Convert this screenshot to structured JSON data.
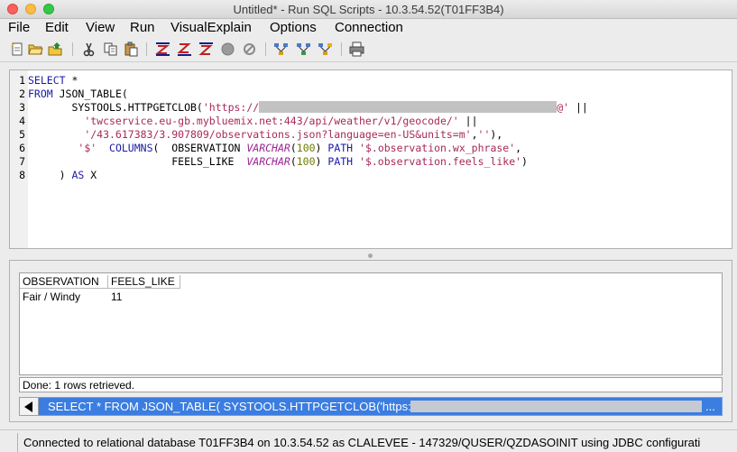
{
  "window": {
    "title": "Untitled* - Run SQL Scripts - 10.3.54.52(T01FF3B4)"
  },
  "menu": [
    "File",
    "Edit",
    "View",
    "Run",
    "VisualExplain",
    "Options",
    "Connection"
  ],
  "editor": {
    "line_numbers": [
      "1",
      "2",
      "3",
      "4",
      "5",
      "6",
      "7",
      "8"
    ],
    "lines": {
      "l1_kw": "SELECT",
      "l1_rest": " *",
      "l2_kw": "FROM",
      "l2_rest": " JSON_TABLE(",
      "l3_pre": "       SYSTOOLS.HTTPGETCLOB(",
      "l3_str1": "'https://",
      "l3_str2": "@'",
      "l3_post": " ||",
      "l4_str": "'twcservice.eu-gb.mybluemix.net:443/api/weather/v1/geocode/'",
      "l4_post": " ||",
      "l5_str": "'/43.617383/3.907809/observations.json?language=en-US&units=m'",
      "l5_mid": ",",
      "l5_str2": "''",
      "l5_post": "),",
      "l6_str": "'$'",
      "l6_kw": "COLUMNS",
      "l6_col": "(  OBSERVATION ",
      "l6_type": "VARCHAR",
      "l6_num": "100",
      "l6_kw2": "PATH",
      "l6_path": "'$.observation.wx_phrase'",
      "l6_end": ",",
      "l7_col": "FEELS_LIKE  ",
      "l7_type": "VARCHAR",
      "l7_num": "100",
      "l7_kw2": "PATH",
      "l7_path": "'$.observation.feels_like'",
      "l7_end": ")",
      "l8_pre": "     ) ",
      "l8_kw": "AS",
      "l8_post": " X"
    }
  },
  "results": {
    "columns": [
      "OBSERVATION",
      "FEELS_LIKE"
    ],
    "rows": [
      [
        "Fair / Windy",
        "11"
      ]
    ],
    "status": "Done: 1 rows retrieved."
  },
  "history": {
    "current_statement": "SELECT * FROM JSON_TABLE( SYSTOOLS.HTTPGETCLOB('https://",
    "overflow": "..."
  },
  "statusbar": {
    "text": "Connected to relational database T01FF3B4 on 10.3.54.52 as CLALEVEE - 147329/QUSER/QZDASOINIT using JDBC configurati"
  },
  "toolbar_icons": [
    "new-file-icon",
    "open-file-icon",
    "save-file-icon",
    "cut-icon",
    "copy-icon",
    "paste-icon",
    "run-all-icon",
    "run-from-selected-icon",
    "run-selected-icon",
    "stop-icon",
    "cancel-icon",
    "visual-explain-icon",
    "run-and-explain-icon",
    "explain-only-icon",
    "print-icon"
  ]
}
